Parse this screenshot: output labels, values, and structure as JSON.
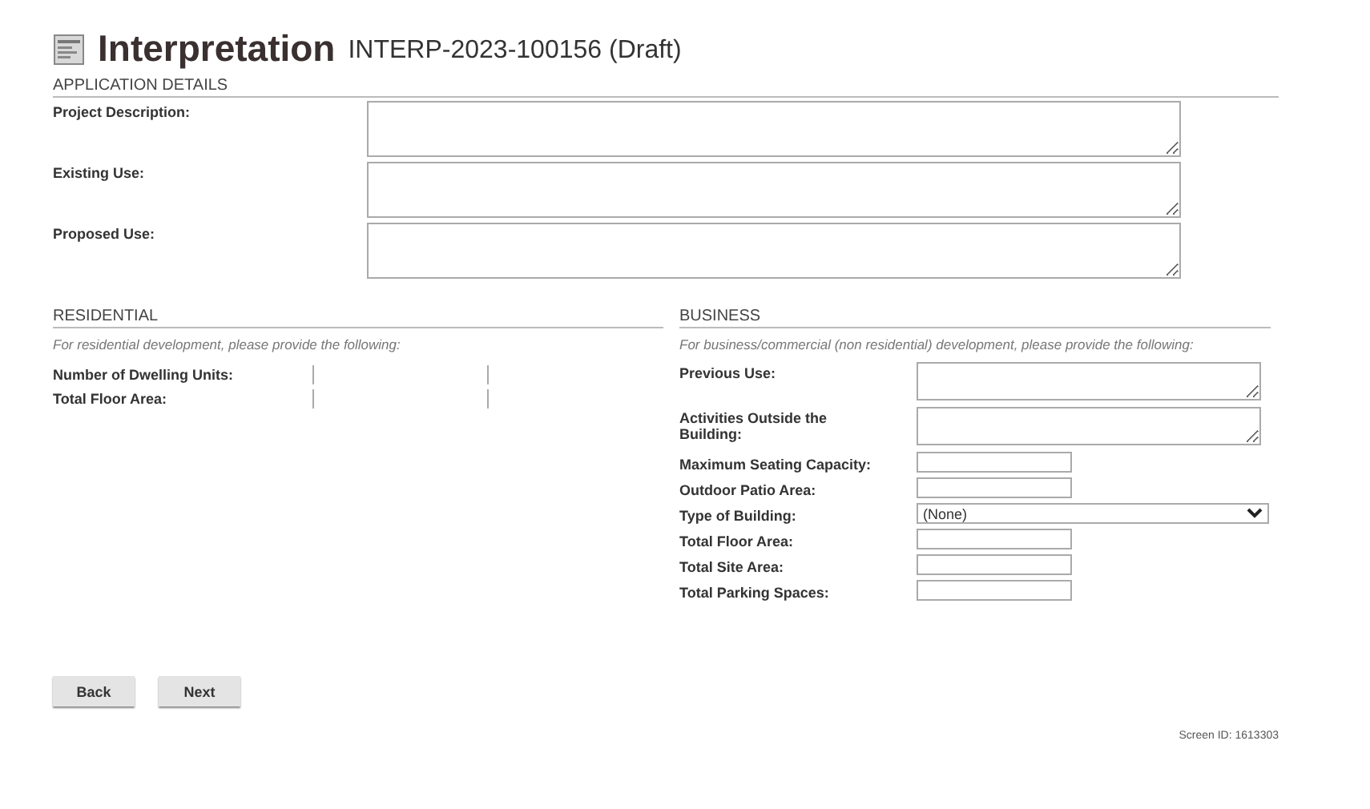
{
  "header": {
    "title": "Interpretation",
    "subtitle": "INTERP-2023-100156 (Draft)"
  },
  "application_details": {
    "heading": "APPLICATION DETAILS",
    "fields": [
      {
        "label": "Project Description:",
        "kind": "textarea"
      },
      {
        "label": "Existing Use:",
        "kind": "textarea"
      },
      {
        "label": "Proposed Use:",
        "kind": "textarea"
      }
    ]
  },
  "residential": {
    "heading": "RESIDENTIAL",
    "note": "For residential development, please provide the following:",
    "fields": [
      {
        "label": "Number of Dwelling Units:",
        "kind": "cells"
      },
      {
        "label": "Total Floor Area:",
        "kind": "cells"
      }
    ]
  },
  "business": {
    "heading": "BUSINESS",
    "note": "For business/commercial (non residential) development, please provide the following:",
    "fields": [
      {
        "label": "Previous Use:",
        "kind": "textarea"
      },
      {
        "label": "Activities Outside the Building:",
        "kind": "textarea"
      },
      {
        "label": "Maximum Seating Capacity:",
        "kind": "input"
      },
      {
        "label": "Outdoor Patio Area:",
        "kind": "input"
      },
      {
        "label": "Type of Building:",
        "kind": "select",
        "value": "(None)"
      },
      {
        "label": "Total Floor Area:",
        "kind": "input"
      },
      {
        "label": "Total Site Area:",
        "kind": "input"
      },
      {
        "label": "Total Parking Spaces:",
        "kind": "input"
      }
    ]
  },
  "buttons": [
    "Back",
    "Next"
  ],
  "footer": "Screen ID: 1613303"
}
